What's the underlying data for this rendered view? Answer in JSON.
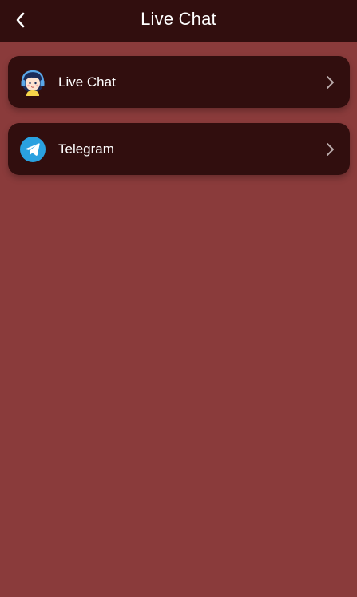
{
  "header": {
    "title": "Live Chat",
    "back_icon": "chevron-left-icon"
  },
  "items": [
    {
      "label": "Live Chat",
      "icon": "support-agent-icon"
    },
    {
      "label": "Telegram",
      "icon": "telegram-icon"
    }
  ],
  "colors": {
    "background": "#8a3b3b",
    "header": "#310e0e",
    "card": "#310e0e",
    "text": "#ffffff",
    "telegram_blue": "#2aa1e0"
  }
}
